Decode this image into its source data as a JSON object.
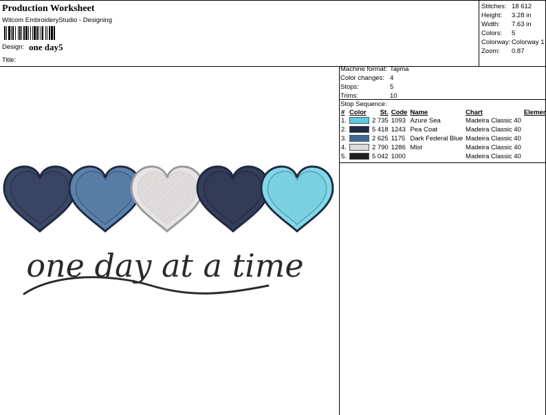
{
  "header": {
    "title": "Production Worksheet",
    "software": "Wilcom EmbroideryStudio - Designing",
    "design_label": "Design:",
    "design_name": "one day5",
    "title_label": "Title:"
  },
  "stats": {
    "stitches_label": "Stitches:",
    "stitches": "18 612",
    "height_label": "Height:",
    "height": "3.28 in",
    "width_label": "Width:",
    "width": "7.63 in",
    "colors_label": "Colors:",
    "colors": "5",
    "colorway_label": "Colorway:",
    "colorway": "Colorway 1",
    "zoom_label": "Zoom:",
    "zoom": "0.87"
  },
  "machine": {
    "format_label": "Machine format:",
    "format": "Tajima",
    "color_changes_label": "Color changes:",
    "color_changes": "4",
    "stops_label": "Stops:",
    "stops": "5",
    "trims_label": "Trims:",
    "trims": "10",
    "stop_sequence_label": "Stop Sequence:"
  },
  "stop_table": {
    "headers": [
      "#",
      "Color",
      "St.",
      "Code",
      "Name",
      "Chart",
      "Element"
    ],
    "rows": [
      {
        "n": "1.",
        "color": "#5bc8e0",
        "st": "2 735",
        "code": "1093",
        "name": "Azure Sea",
        "chart": "Madeira Classic 40"
      },
      {
        "n": "2.",
        "color": "#1c2a47",
        "st": "5 418",
        "code": "1243",
        "name": "Pea Coat",
        "chart": "Madeira Classic 40"
      },
      {
        "n": "3.",
        "color": "#3f6a96",
        "st": "2 625",
        "code": "1175",
        "name": "Dark Federal Blue",
        "chart": "Madeira Classic 40"
      },
      {
        "n": "4.",
        "color": "#dcdcdc",
        "st": "2 790",
        "code": "1286",
        "name": "Mist",
        "chart": "Madeira Classic 40"
      },
      {
        "n": "5.",
        "color": "#1e1e1e",
        "st": "5 042",
        "code": "1000",
        "name": "",
        "chart": "Madeira Classic 40"
      }
    ]
  },
  "preview": {
    "text": "one day at a time",
    "hearts": [
      "#3a4766",
      "#5b82ad",
      "#e7e4e4",
      "#343d5a",
      "#7fd9ea"
    ],
    "text_color": "#2a2a2a"
  }
}
